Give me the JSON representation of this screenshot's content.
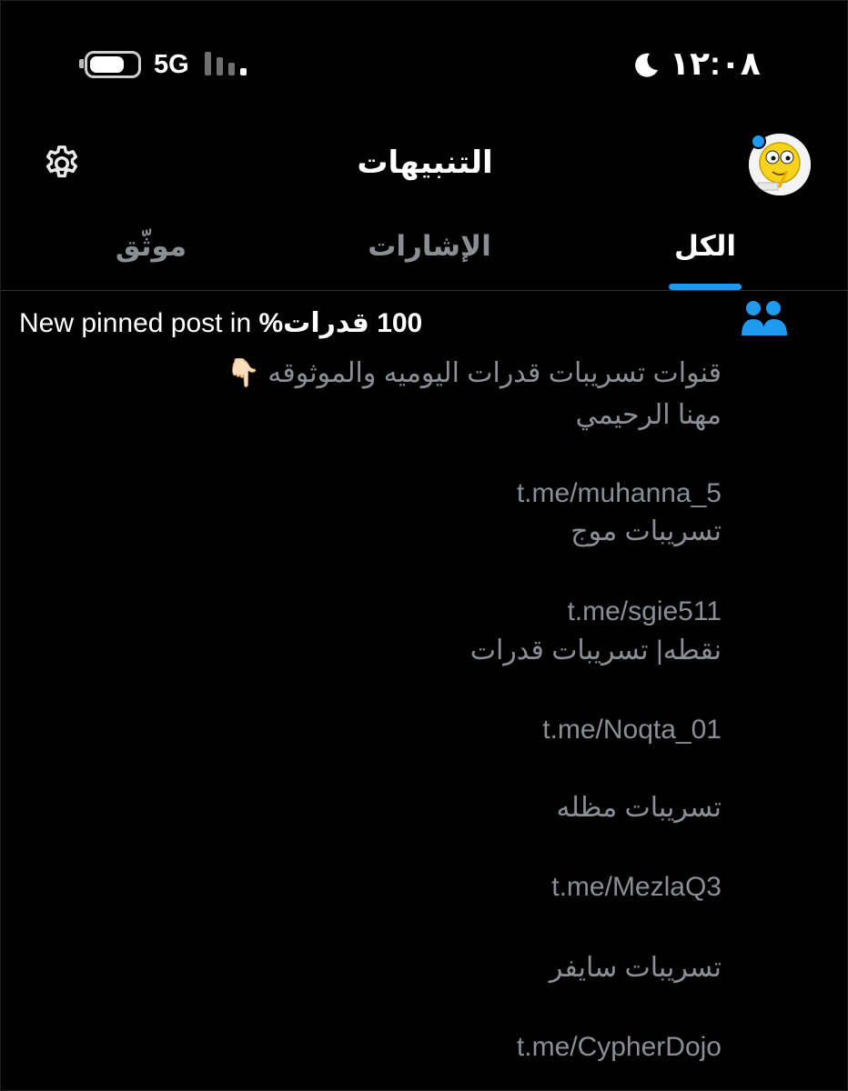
{
  "status_bar": {
    "network": "5G",
    "time": "١٢:٠٨"
  },
  "header": {
    "title": "التنبيهات"
  },
  "tabs": [
    {
      "label": "الكل",
      "selected": true
    },
    {
      "label": "الإشارات",
      "selected": false
    },
    {
      "label": "موثّق",
      "selected": false
    }
  ],
  "notification": {
    "title_prefix": "New pinned post in ",
    "title_group": "100 قدرات%",
    "lines": [
      "قنوات تسريبات قدرات اليوميه والموثوقه 👇🏻",
      "مهنا الرحيمي",
      "t.me/muhanna_5",
      "تسريبات موج",
      "t.me/sgie511",
      "نقطه| تسريبات قدرات",
      "t.me/Noqta_01",
      "تسريبات مظله",
      "t.me/MezlaQ3",
      "تسريبات سايفر",
      "t.me/CypherDojo"
    ]
  },
  "colors": {
    "accent": "#1d9bf0",
    "background": "#000000",
    "muted_text": "#8b8f94"
  }
}
